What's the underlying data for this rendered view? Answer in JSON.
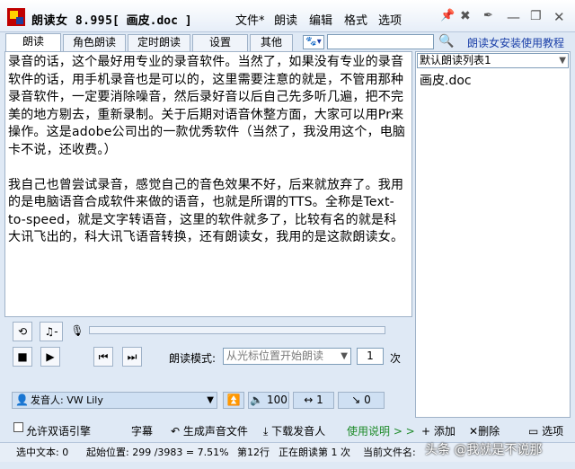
{
  "app": {
    "title": "朗读女 8.995",
    "doc": "[ 画皮.doc ]"
  },
  "menu": [
    "文件*",
    "朗读",
    "编辑",
    "格式",
    "选项"
  ],
  "tabs": [
    "朗读",
    "角色朗读",
    "定时朗读",
    "设置",
    "其他"
  ],
  "search": {
    "value": ""
  },
  "help_link": "朗读女安装使用教程",
  "editor": {
    "para1": "录音的话，这个最好用专业的录音软件。当然了，如果没有专业的录音软件的话，用手机录音也是可以的，这里需要注意的就是，不管用那种录音软件，一定要消除噪音，然后录好音以后自己先多听几遍，把不完美的地方剔去，重新录制。关于后期对语音休整方面，大家可以用Pr来操作。这是adobe公司出的一款优秀软件（当然了，我没用这个，电脑卡不说，还收费。）",
    "para2": "我自己也曾尝试录音，感觉自己的音色效果不好，后来就放弃了。我用的是电脑语音合成软件来做的语音，也就是所谓的TTS。全称是Text-to-speed，就是文字转语音，这里的软件就多了，比较有名的就是科大讯飞出的，科大讯飞语音转换，还有朗读女，我用的是这款朗读女。"
  },
  "playlist": {
    "selected": "默认朗读列表1",
    "items": [
      "画皮.doc"
    ]
  },
  "playback": {
    "mode_label": "朗读模式:",
    "mode_value": "从光标位置开始朗读",
    "count": "1",
    "count_unit": "次"
  },
  "voice": {
    "label": "发音人: VW Lily",
    "volume": "100",
    "speed": "1",
    "pitch": "0"
  },
  "actions": {
    "bilingual": "允许双语引擎",
    "subtitle": "字幕",
    "generate": "生成声音文件",
    "download": "下载发音人",
    "guide": "使用说明 > >"
  },
  "list_actions": {
    "add": "+ 添加",
    "delete": "删除",
    "options": "选项"
  },
  "status": {
    "selected": "选中文本: 0",
    "start": "起始位置: 299 /3983 = 7.51%",
    "line": "第12行",
    "reading": "正在朗读第 1 次",
    "filename": "当前文件名:"
  },
  "watermark": "头条 @我就是不说那",
  "colors": {
    "link": "#1a3fa8",
    "panel": "#dfe9f5",
    "accent_bar": "#cfe0f3"
  }
}
